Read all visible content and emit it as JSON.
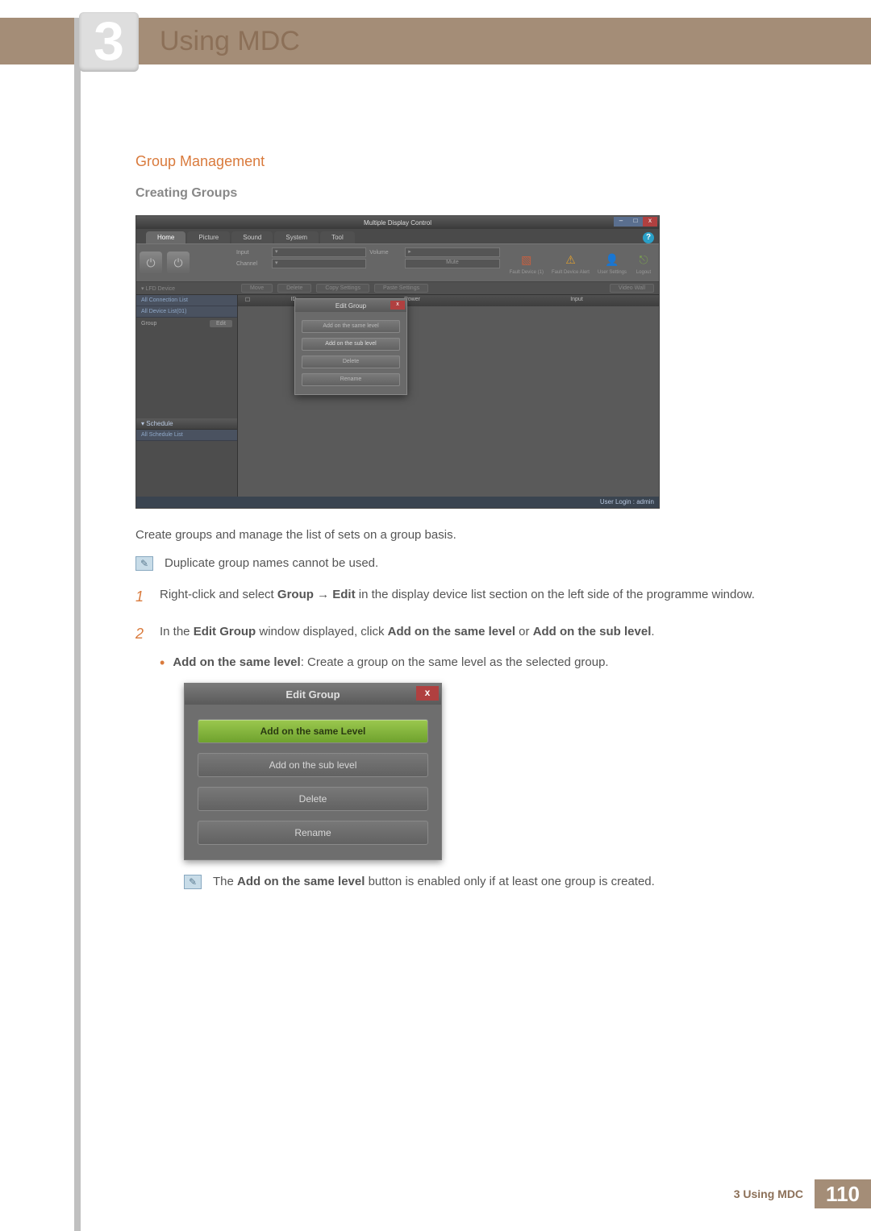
{
  "chapter": {
    "number": "3",
    "title": "Using MDC"
  },
  "section": {
    "heading": "Group Management",
    "subheading": "Creating Groups"
  },
  "mdc": {
    "title": "Multiple Display Control",
    "help": "?",
    "tabs": [
      "Home",
      "Picture",
      "Sound",
      "System",
      "Tool"
    ],
    "toolbar": {
      "inputLabel": "Input",
      "channelLabel": "Channel",
      "volumeLabel": "Volume",
      "muteLabel": "Mute",
      "icons": {
        "fault": "Fault Device (1)",
        "alert": "Fault Device Alert",
        "user": "User Settings",
        "logout": "Logout"
      }
    },
    "actionbar": {
      "lfd": "▾ LFD Device",
      "move": "Move",
      "delete": "Delete",
      "copy": "Copy Settings",
      "paste": "Paste Settings",
      "wall": "Video Wall"
    },
    "side": {
      "connList": "All Connection List",
      "devList": "All Device List(01)",
      "groupLabel": "Group",
      "editBtn": "Edit",
      "schedule": "▾ Schedule",
      "schedList": "All Schedule List"
    },
    "mainHead": {
      "id": "ID",
      "power": "Power",
      "input": "Input"
    },
    "popup": {
      "title": "Edit Group",
      "btnSame": "Add on the same level",
      "btnSub": "Add on the sub level",
      "btnDel": "Delete",
      "btnRen": "Rename"
    },
    "status": "User Login : admin"
  },
  "body": {
    "p1": "Create groups and manage the list of sets on a group basis.",
    "note1": "Duplicate group names cannot be used.",
    "step1a": "Right-click and select ",
    "step1b": "Group",
    "step1arrow": " → ",
    "step1c": "Edit",
    "step1d": " in the display device list section on the left side of the programme window.",
    "step2a": "In the ",
    "step2b": "Edit Group",
    "step2c": " window displayed, click ",
    "step2d": "Add on the same level",
    "step2e": " or ",
    "step2f": "Add on the sub level",
    "step2g": ".",
    "bullet1a": "Add on the same level",
    "bullet1b": ": Create a group on the same level as the selected group."
  },
  "dlg2": {
    "title": "Edit Group",
    "same": "Add on the same Level",
    "sub": "Add on the sub level",
    "del": "Delete",
    "ren": "Rename"
  },
  "note2a": "The ",
  "note2b": "Add on the same level",
  "note2c": " button is enabled only if at least one group is created.",
  "footer": {
    "label": "3 Using MDC",
    "page": "110"
  }
}
